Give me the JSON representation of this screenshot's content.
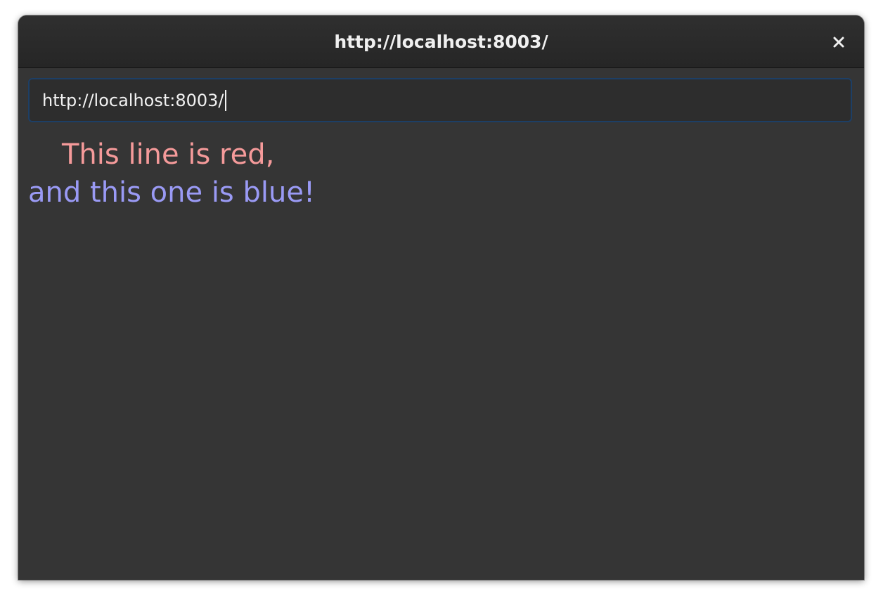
{
  "window": {
    "title": "http://localhost:8003/"
  },
  "toolbar": {
    "close_icon": "close-icon"
  },
  "address_bar": {
    "value": "http://localhost:8003/"
  },
  "page": {
    "line1": "This line is red,",
    "line2": "and this one is blue!",
    "line1_color": "#f59a9a",
    "line2_color": "#9a9af5"
  },
  "colors": {
    "window_bg": "#353535",
    "titlebar_bg": "#2a2a2a",
    "focus_border": "#1d3f66"
  }
}
